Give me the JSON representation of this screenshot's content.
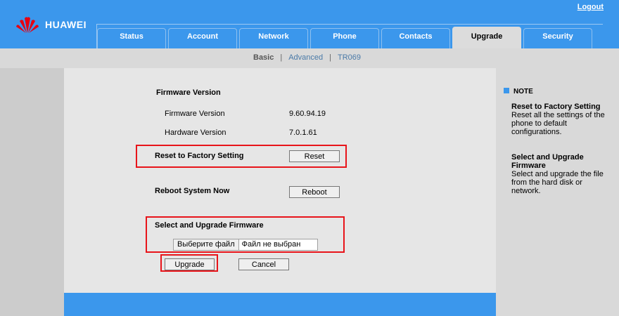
{
  "header": {
    "brand": "HUAWEI",
    "logout_label": "Logout",
    "tabs": [
      {
        "label": "Status"
      },
      {
        "label": "Account"
      },
      {
        "label": "Network"
      },
      {
        "label": "Phone"
      },
      {
        "label": "Contacts"
      },
      {
        "label": "Upgrade",
        "active": true
      },
      {
        "label": "Security"
      }
    ]
  },
  "subnav": {
    "items": [
      {
        "label": "Basic",
        "active": true
      },
      {
        "label": "Advanced"
      },
      {
        "label": "TR069"
      }
    ]
  },
  "firmware": {
    "section_title": "Firmware Version",
    "firmware_label": "Firmware Version",
    "firmware_value": "9.60.94.19",
    "hardware_label": "Hardware Version",
    "hardware_value": "7.0.1.61"
  },
  "factory": {
    "label": "Reset to Factory Setting",
    "button": "Reset"
  },
  "reboot": {
    "label": "Reboot System Now",
    "button": "Reboot"
  },
  "upgrade": {
    "label": "Select and Upgrade Firmware",
    "choose_file": "Выберите файл",
    "no_file": "Файл не выбран",
    "upgrade_button": "Upgrade",
    "cancel_button": "Cancel"
  },
  "note": {
    "title": "NOTE",
    "items": [
      {
        "heading": "Reset to Factory Setting",
        "body": "Reset all the settings of the phone to default configurations."
      },
      {
        "heading": "Select and Upgrade Firmware",
        "body": "Select and upgrade the file from the hard disk or network."
      }
    ]
  },
  "colors": {
    "brand_blue": "#3b97ec",
    "highlight_red": "#e8141a",
    "logo_red": "#e60012"
  }
}
